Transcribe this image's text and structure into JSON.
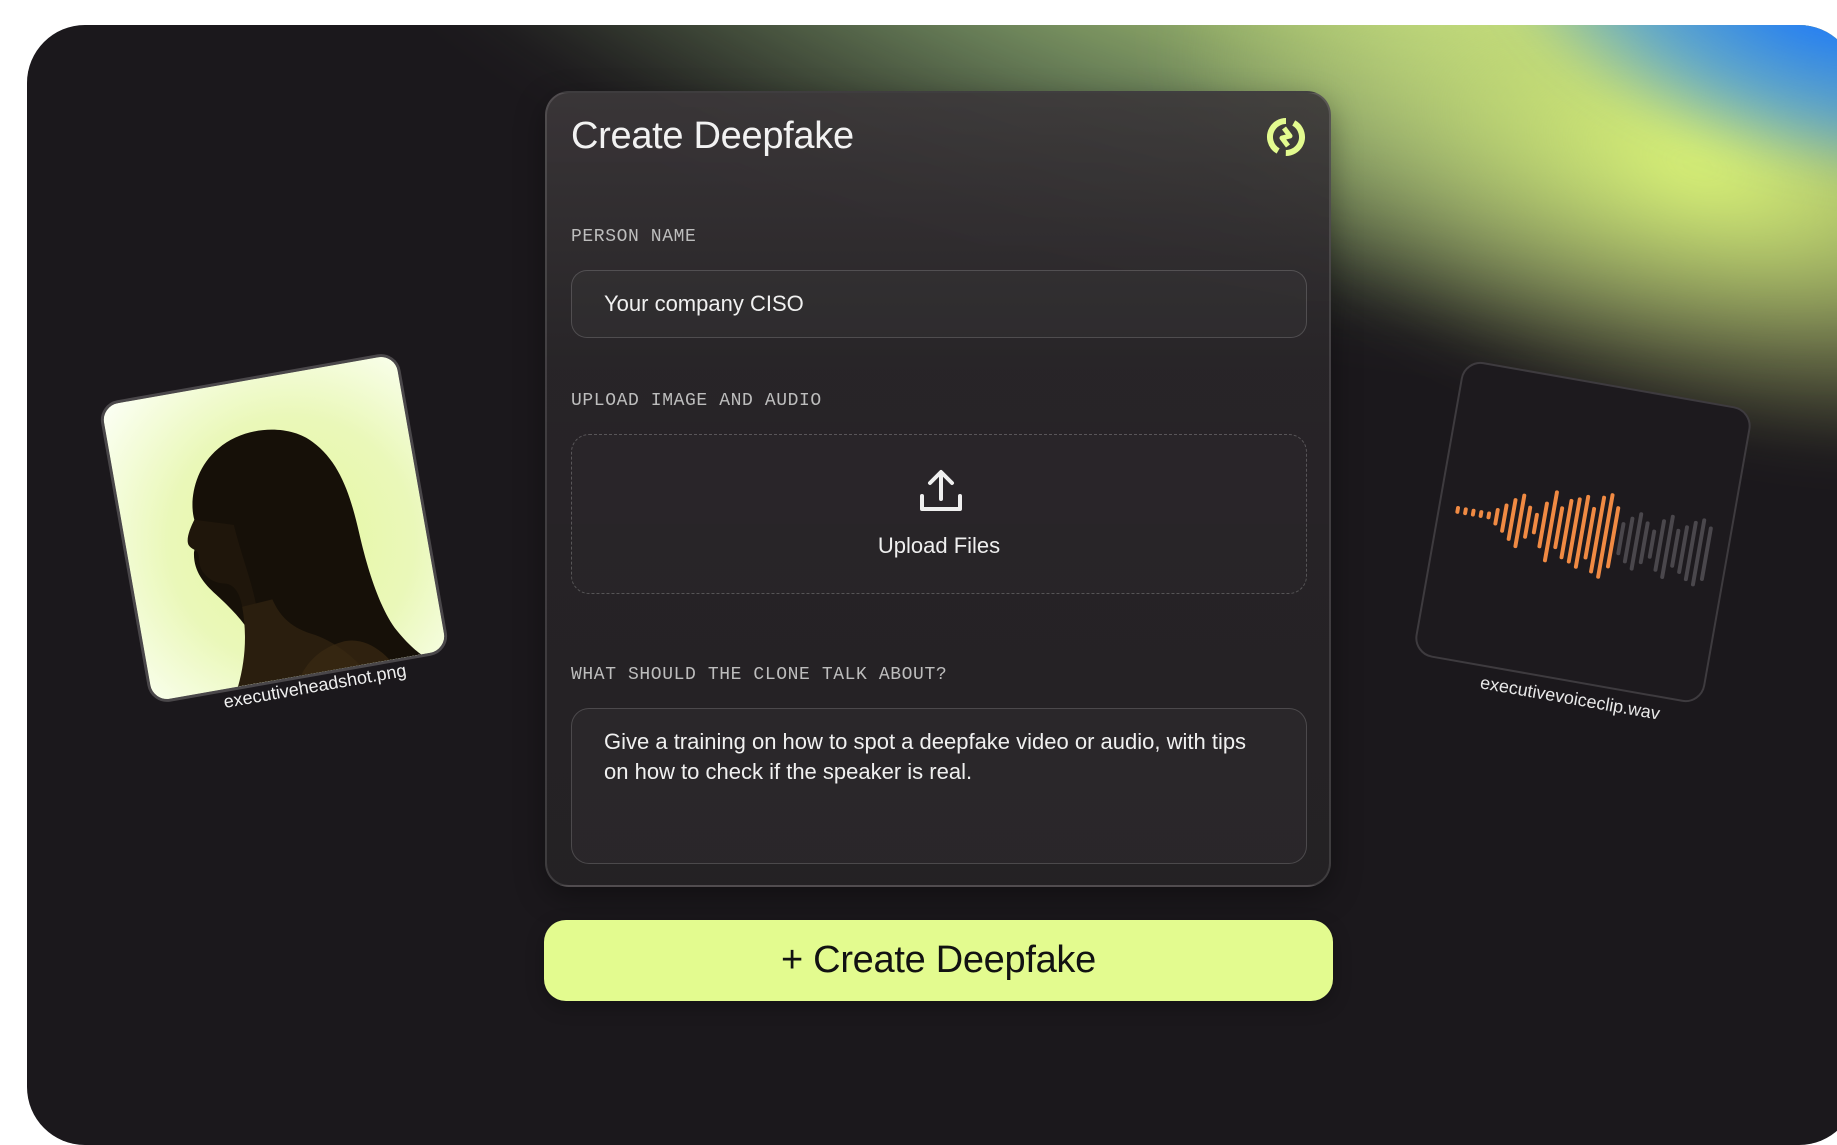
{
  "form": {
    "title": "Create Deepfake",
    "person_name_label": "PERSON NAME",
    "person_name_value": "Your company CISO",
    "upload_label": "UPLOAD IMAGE AND AUDIO",
    "upload_button_label": "Upload Files",
    "topic_label": "WHAT SHOULD THE CLONE TALK ABOUT?",
    "topic_value": "Give a training on how to spot a deepfake video or audio, with tips on how to check if the speaker is real."
  },
  "actions": {
    "create_label": "+ Create Deepfake"
  },
  "files": {
    "image_name": "executiveheadshot.png",
    "audio_name": "executivevoiceclip.wav"
  },
  "icons": {
    "logo": "logo-icon",
    "upload": "upload-icon",
    "waveform": "waveform-icon"
  },
  "colors": {
    "accent": "#e3fb8f",
    "waveform_active": "#f08a43",
    "waveform_inactive": "#4a474c",
    "background": "#1b181c",
    "glow_blue": "#1a78ff"
  }
}
